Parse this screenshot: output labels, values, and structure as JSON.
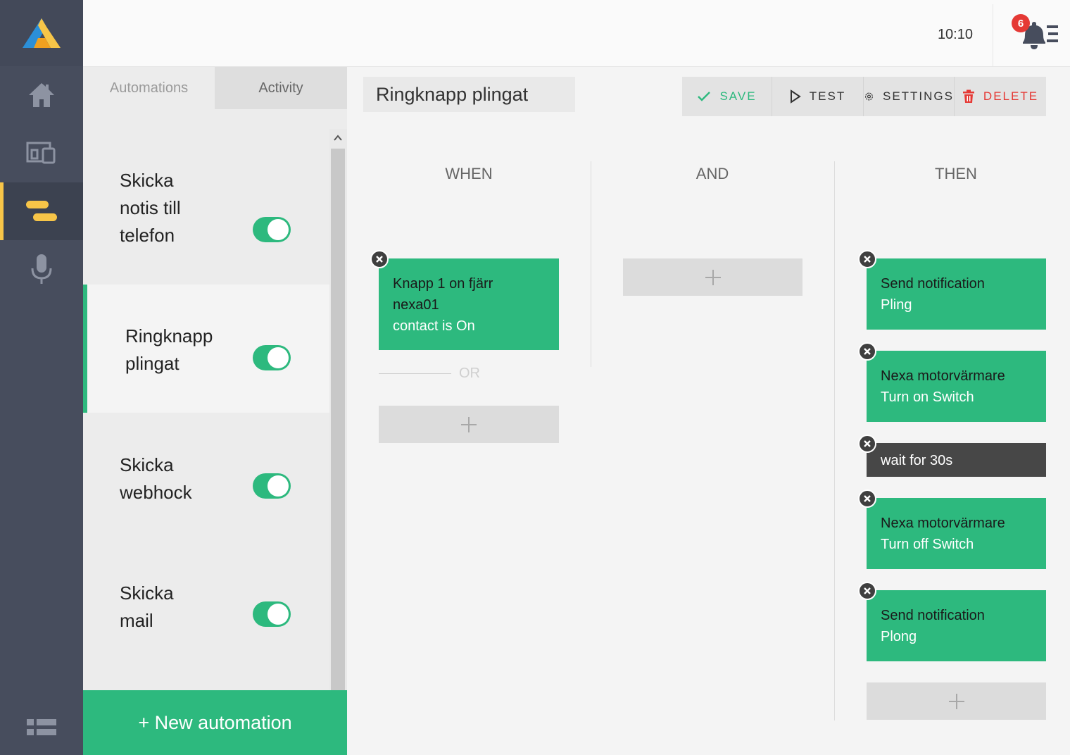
{
  "topbar": {
    "clock": "10:10",
    "notification_count": "6"
  },
  "nav": {
    "items": [
      {
        "icon": "home-icon"
      },
      {
        "icon": "devices-icon"
      },
      {
        "icon": "automations-icon",
        "active": true
      },
      {
        "icon": "microphone-icon"
      }
    ],
    "bottom_icon": "list-view-icon"
  },
  "list": {
    "tabs": [
      {
        "label": "Automations"
      },
      {
        "label": "Activity"
      }
    ],
    "items": [
      {
        "lines": [
          "Skicka",
          "notis till",
          "telefon"
        ],
        "enabled": true
      },
      {
        "lines": [
          "Ringknapp",
          "plingat"
        ],
        "enabled": true,
        "selected": true
      },
      {
        "lines": [
          "Skicka",
          "webhock"
        ],
        "enabled": true
      },
      {
        "lines": [
          "Skicka",
          "mail"
        ],
        "enabled": true
      }
    ],
    "new_button": "+ New automation"
  },
  "editor": {
    "name": "Ringknapp plingat",
    "toolbar": {
      "save": "SAVE",
      "test": "TEST",
      "settings": "SETTINGS",
      "delete": "DELETE"
    },
    "columns": {
      "when": "WHEN",
      "and": "AND",
      "then": "THEN"
    },
    "when": {
      "cards": [
        {
          "line1": "Knapp 1 on fjärr",
          "line2": "nexa01",
          "line3": "contact is On"
        }
      ],
      "or_label": "OR"
    },
    "then": {
      "cards": [
        {
          "line1": "Send notification",
          "line2": "Pling"
        },
        {
          "line1": "Nexa motorvärmare",
          "line2": "Turn on Switch"
        },
        {
          "line1": "wait for 30s",
          "dark": true
        },
        {
          "line1": "Nexa motorvärmare",
          "line2": "Turn off Switch"
        },
        {
          "line1": "Send notification",
          "line2": "Plong"
        }
      ]
    }
  },
  "colors": {
    "accent": "#2db97e",
    "rail": "#474d5d",
    "danger": "#e53935",
    "highlight": "#f7c548"
  }
}
